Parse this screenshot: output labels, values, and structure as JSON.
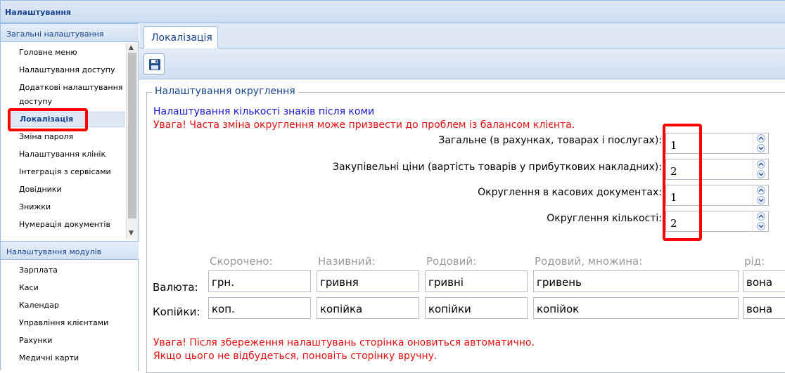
{
  "window": {
    "title": "Налаштування"
  },
  "sidebar": {
    "general_header": "Загальні налаштування",
    "general_items": [
      {
        "label": "Головне меню"
      },
      {
        "label": "Налаштування доступу"
      },
      {
        "label_line1": "Додаткові налаштування",
        "label_line2": "доступу"
      },
      {
        "label": "Локалізація"
      },
      {
        "label": "Зміна пароля"
      },
      {
        "label": "Налаштування клінік"
      },
      {
        "label": "Інтеграція з сервісами"
      },
      {
        "label": "Довідники"
      },
      {
        "label": "Знижки"
      },
      {
        "label": "Нумерація документів"
      }
    ],
    "active_item": "Локалізація",
    "modules_header": "Налаштування модулів",
    "module_items": [
      {
        "label": "Зарплата"
      },
      {
        "label": "Каси"
      },
      {
        "label": "Календар"
      },
      {
        "label": "Управління клієнтами"
      },
      {
        "label": "Рахунки"
      },
      {
        "label": "Медичні карти"
      }
    ]
  },
  "tabs": [
    {
      "label": "Локалізація"
    }
  ],
  "toolbar": {
    "save_icon": "floppy-disk-icon"
  },
  "rounding": {
    "legend": "Налаштування округлення",
    "info": "Налаштування кількості знаків після коми",
    "warning": "Увага! Часта зміна округлення може призвести до проблем із балансом клієнта.",
    "rows": [
      {
        "label": "Загальне (в рахунках, товарах і послугах):",
        "value": "1"
      },
      {
        "label": "Закупівельні ціни (вартість товарів у прибуткових накладних):",
        "value": "2"
      },
      {
        "label": "Округлення в касових документах:",
        "value": "1"
      },
      {
        "label": "Округлення кількості:",
        "value": "2"
      }
    ]
  },
  "currency": {
    "columns": [
      "Скорочено:",
      "Називний:",
      "Родовий:",
      "Родовий, множина:",
      "рід:"
    ],
    "rows": [
      {
        "label": "Валюта:",
        "values": [
          "грн.",
          "гривня",
          "гривні",
          "гривень",
          "вона"
        ]
      },
      {
        "label": "Копійки:",
        "values": [
          "коп.",
          "копійка",
          "копійки",
          "копійок",
          "вона"
        ]
      }
    ]
  },
  "footer_warning": {
    "line1": "Увага! Після збереження налаштувань сторінка оновиться автоматично.",
    "line2": "Якщо цього не відбудеться, поновіть сторінку вручну."
  },
  "colors": {
    "accent": "#15428b",
    "warning": "#e01010",
    "info": "#1515c8",
    "highlight": "#ff0000"
  }
}
